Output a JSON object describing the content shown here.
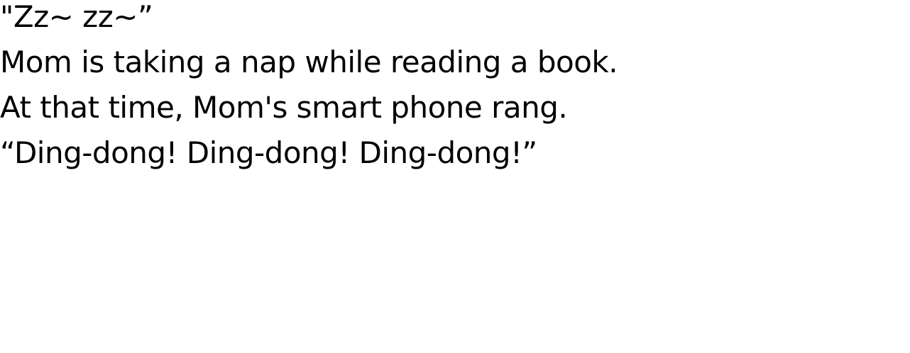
{
  "story": {
    "lines": [
      "\"Zz~ zz~”",
      "Mom is taking a nap while reading a book.",
      "At that time, Mom's smart phone rang.",
      "“Ding-dong! Ding-dong! Ding-dong!”"
    ]
  },
  "colors": {
    "background": "#ffffff",
    "text": "#000000"
  }
}
